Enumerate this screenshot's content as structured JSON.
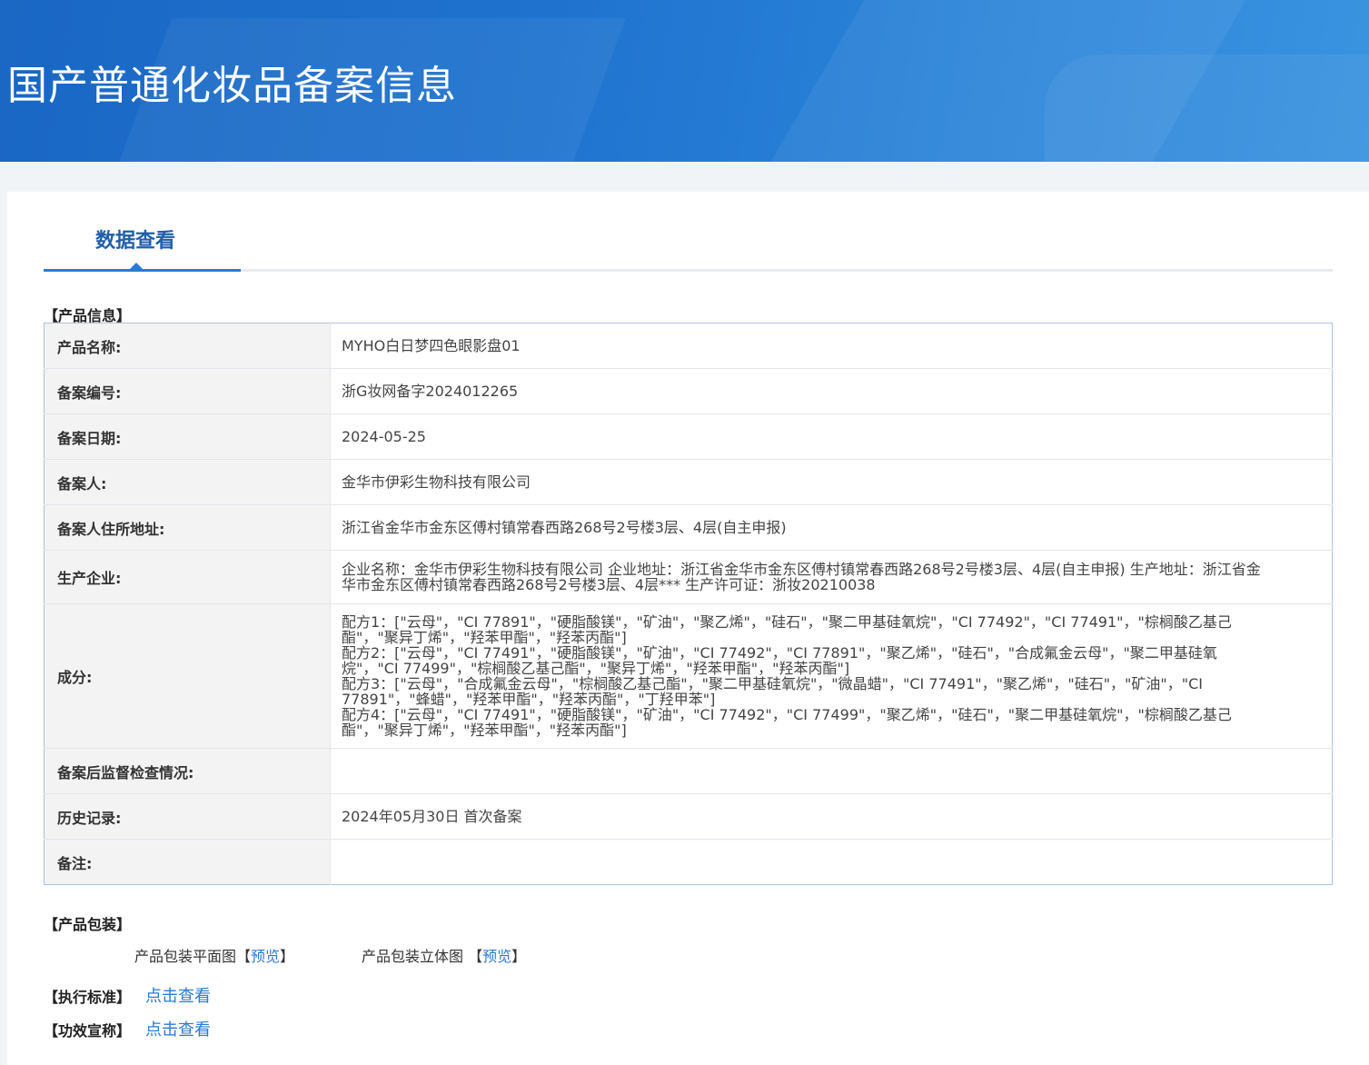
{
  "header": {
    "title": "国产普通化妆品备案信息"
  },
  "tab": {
    "label": "数据查看"
  },
  "product_info": {
    "section_title": "【产品信息】",
    "rows": [
      {
        "label": "产品名称:",
        "value": "MYHO白日梦四色眼影盘01"
      },
      {
        "label": "备案编号:",
        "value": "浙G妆网备字2024012265"
      },
      {
        "label": "备案日期:",
        "value": "2024-05-25"
      },
      {
        "label": "备案人:",
        "value": "金华市伊彩生物科技有限公司"
      },
      {
        "label": "备案人住所地址:",
        "value": "浙江省金华市金东区傅村镇常春西路268号2号楼3层、4层(自主申报)"
      },
      {
        "label": "生产企业:",
        "value": "企业名称：金华市伊彩生物科技有限公司 企业地址：浙江省金华市金东区傅村镇常春西路268号2号楼3层、4层(自主申报) 生产地址：浙江省金华市金东区傅村镇常春西路268号2号楼3层、4层*** 生产许可证：浙妆20210038"
      },
      {
        "label": "成分:",
        "formulas": [
          "配方1：[\"云母\"，\"CI 77891\"，\"硬脂酸镁\"，\"矿油\"，\"聚乙烯\"，\"硅石\"，\"聚二甲基硅氧烷\"，\"CI 77492\"，\"CI 77491\"，\"棕榈酸乙基己酯\"，\"聚异丁烯\"，\"羟苯甲酯\"，\"羟苯丙酯\"]",
          "配方2：[\"云母\"，\"CI 77491\"，\"硬脂酸镁\"，\"矿油\"，\"CI 77492\"，\"CI 77891\"，\"聚乙烯\"，\"硅石\"，\"合成氟金云母\"，\"聚二甲基硅氧烷\"，\"CI 77499\"，\"棕榈酸乙基己酯\"，\"聚异丁烯\"，\"羟苯甲酯\"，\"羟苯丙酯\"]",
          "配方3：[\"云母\"，\"合成氟金云母\"，\"棕榈酸乙基己酯\"，\"聚二甲基硅氧烷\"，\"微晶蜡\"，\"CI 77491\"，\"聚乙烯\"，\"硅石\"，\"矿油\"，\"CI 77891\"，\"蜂蜡\"，\"羟苯甲酯\"，\"羟苯丙酯\"，\"丁羟甲苯\"]",
          "配方4：[\"云母\"，\"CI 77491\"，\"硬脂酸镁\"，\"矿油\"，\"CI 77492\"，\"CI 77499\"，\"聚乙烯\"，\"硅石\"，\"聚二甲基硅氧烷\"，\"棕榈酸乙基己酯\"，\"聚异丁烯\"，\"羟苯甲酯\"，\"羟苯丙酯\"]"
        ]
      },
      {
        "label": "备案后监督检查情况:",
        "value": ""
      },
      {
        "label": "历史记录:",
        "value": "2024年05月30日 首次备案"
      },
      {
        "label": "备注:",
        "value": ""
      }
    ]
  },
  "packaging": {
    "section_title": "【产品包装】",
    "flat_label": "产品包装平面图",
    "three_d_label": "产品包装立体图",
    "bracket_open": "【",
    "bracket_close": "】",
    "preview_link": "预览"
  },
  "standard": {
    "section_title": "【执行标准】",
    "link": "点击查看"
  },
  "efficacy": {
    "section_title": "【功效宣称】",
    "link": "点击查看"
  }
}
